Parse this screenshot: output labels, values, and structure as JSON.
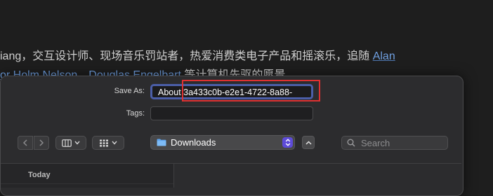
{
  "background": {
    "line1_text": "iang，交互设计师、现场音乐罚站者，热爱消费类电子产品和摇滚乐，追随 ",
    "line1_link": "Alan",
    "line2_link1": "or Holm Nelson",
    "line2_sep": "、",
    "line2_link2": "Douglas Engelbart",
    "line2_text": " 等计算机先驱的愿景。"
  },
  "dialog": {
    "save_as_label": "Save As:",
    "filename_prefix": "About ",
    "filename_selected": "3a433c0b-e2e1-4722-8a88-",
    "tags_label": "Tags:",
    "tags_value": "",
    "location": "Downloads",
    "search_placeholder": "Search",
    "sidebar_header": "Today"
  },
  "icons": {
    "back": "chevron-left-icon",
    "forward": "chevron-right-icon",
    "columns": "columns-view-icon",
    "grid": "grid-view-icon",
    "folder": "folder-icon",
    "stepper": "up-down-stepper-icon",
    "expand": "chevron-up-icon",
    "search": "search-icon"
  },
  "colors": {
    "accent": "#5d4bd8",
    "focus_ring": "#4b5ea8",
    "annotation": "#e03131",
    "link": "#6f9fe0"
  }
}
